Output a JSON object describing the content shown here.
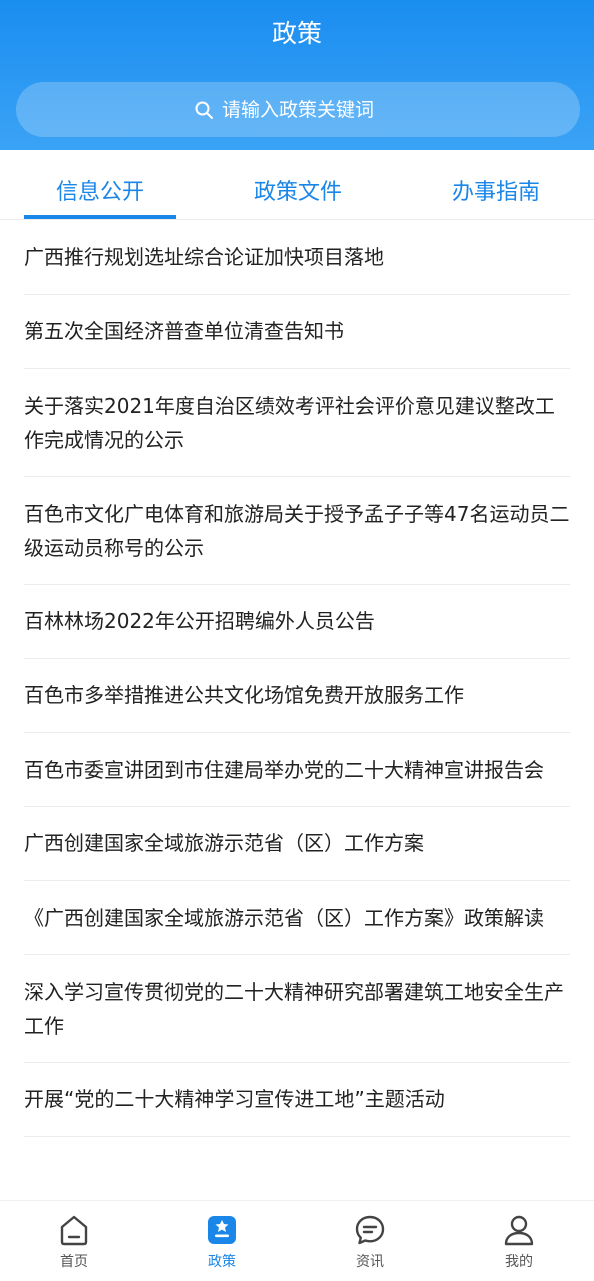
{
  "header": {
    "title": "政策",
    "search_placeholder": "请输入政策关键词"
  },
  "tabs": [
    {
      "label": "信息公开",
      "active": true
    },
    {
      "label": "政策文件",
      "active": false
    },
    {
      "label": "办事指南",
      "active": false
    }
  ],
  "news": [
    "广西推行规划选址综合论证加快项目落地",
    "第五次全国经济普查单位清查告知书",
    "关于落实2021年度自治区绩效考评社会评价意见建议整改工作完成情况的公示",
    "百色市文化广电体育和旅游局关于授予孟子子等47名运动员二级运动员称号的公示",
    "百林林场2022年公开招聘编外人员公告",
    "百色市多举措推进公共文化场馆免费开放服务工作",
    "百色市委宣讲团到市住建局举办党的二十大精神宣讲报告会",
    "广西创建国家全域旅游示范省（区）工作方案",
    "《广西创建国家全域旅游示范省（区）工作方案》政策解读",
    "深入学习宣传贯彻党的二十大精神研究部署建筑工地安全生产工作",
    "开展“党的二十大精神学习宣传进工地”主题活动"
  ],
  "bottom_nav": [
    {
      "label": "首页",
      "icon": "home-icon",
      "active": false
    },
    {
      "label": "政策",
      "icon": "policy-icon",
      "active": true
    },
    {
      "label": "资讯",
      "icon": "message-icon",
      "active": false
    },
    {
      "label": "我的",
      "icon": "profile-icon",
      "active": false
    }
  ],
  "colors": {
    "accent": "#1a86e8",
    "header_top": "#1a8df0",
    "header_bottom": "#3ba3f5",
    "text": "#222222",
    "nav_text": "#555555"
  }
}
